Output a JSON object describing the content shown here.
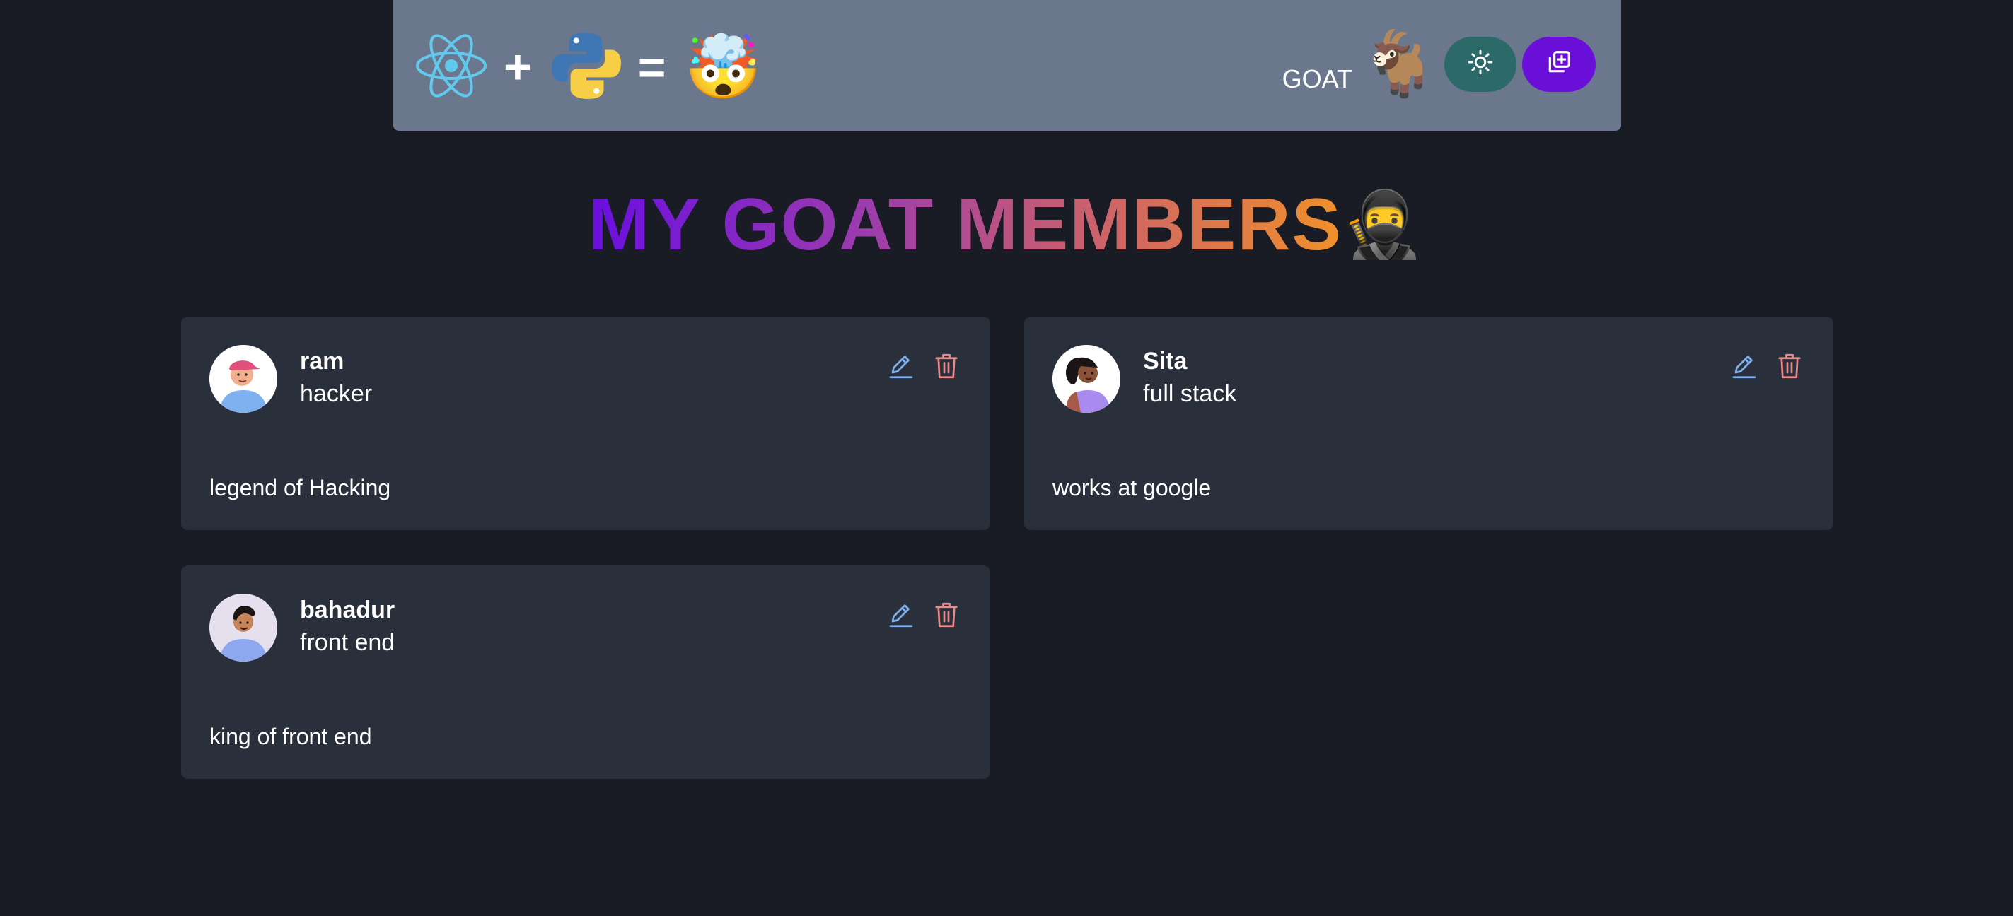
{
  "header": {
    "plus_symbol": "+",
    "equals_symbol": "=",
    "mind_blown_emoji": "🤯",
    "brand_label": "GOAT",
    "goat_emoji": "🐐",
    "icons": {
      "react": "react-logo-icon",
      "python": "python-logo-icon",
      "theme": "sun-icon",
      "add": "add-square-icon"
    }
  },
  "title": {
    "text": "MY GOAT MEMBERS",
    "emoji": "🥷"
  },
  "members": [
    {
      "name": "ram",
      "role": "hacker",
      "description": "legend of Hacking"
    },
    {
      "name": "Sita",
      "role": "full stack",
      "description": "works at google"
    },
    {
      "name": "bahadur",
      "role": "front end",
      "description": "king of front end"
    }
  ],
  "colors": {
    "background": "#1a1c25",
    "topbar": "#6b778d",
    "card": "#2a2f3c",
    "theme_button": "#2c6a6a",
    "add_button": "#6a0fd8",
    "edit_icon": "#7fb2ee",
    "delete_icon": "#f08a8a"
  }
}
